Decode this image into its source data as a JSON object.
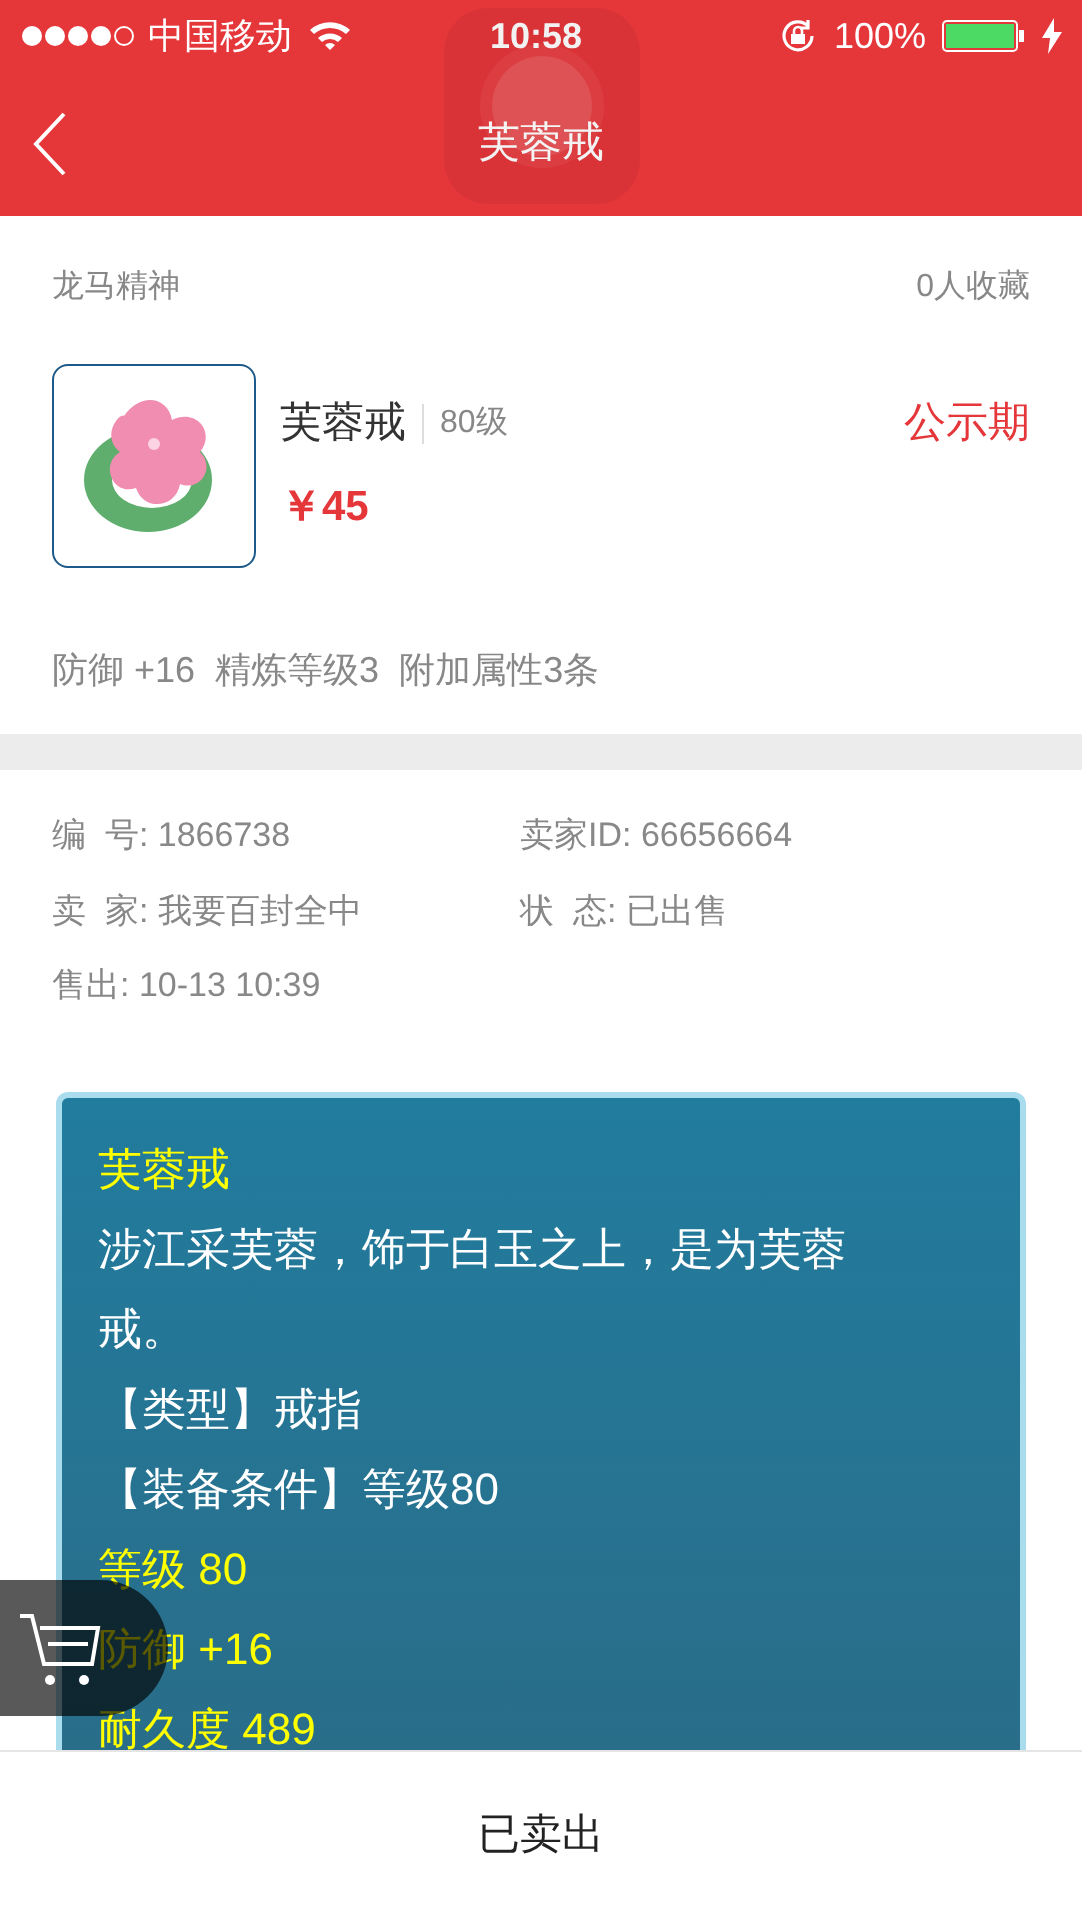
{
  "status_bar": {
    "carrier": "中国移动",
    "time": "10:58",
    "battery": "100%"
  },
  "nav": {
    "title": "芙蓉戒"
  },
  "listing": {
    "server": "龙马精神",
    "favorites": "0人收藏"
  },
  "item": {
    "name": "芙蓉戒",
    "level": "80级",
    "price": "￥45",
    "status": "公示期",
    "attributes": [
      "防御 +16",
      "精炼等级3",
      "附加属性3条"
    ]
  },
  "details": [
    "编  号: 1866738",
    "卖家ID: 66656664",
    "卖  家: 我要百封全中",
    "状  态: 已出售",
    "售出: 10-13 10:39"
  ],
  "description": [
    {
      "kind": "title",
      "text": "芙蓉戒"
    },
    {
      "kind": "text",
      "text": "涉江采芙蓉，饰于白玉之上，是为芙蓉戒。"
    },
    {
      "kind": "text",
      "text": "【类型】戒指"
    },
    {
      "kind": "text",
      "text": "【装备条件】等级80"
    },
    {
      "kind": "stat",
      "text": "等级 80"
    },
    {
      "kind": "stat",
      "text": "防御 +16"
    },
    {
      "kind": "stat",
      "text": "耐久度 489"
    }
  ],
  "bottom_button": "已卖出"
}
